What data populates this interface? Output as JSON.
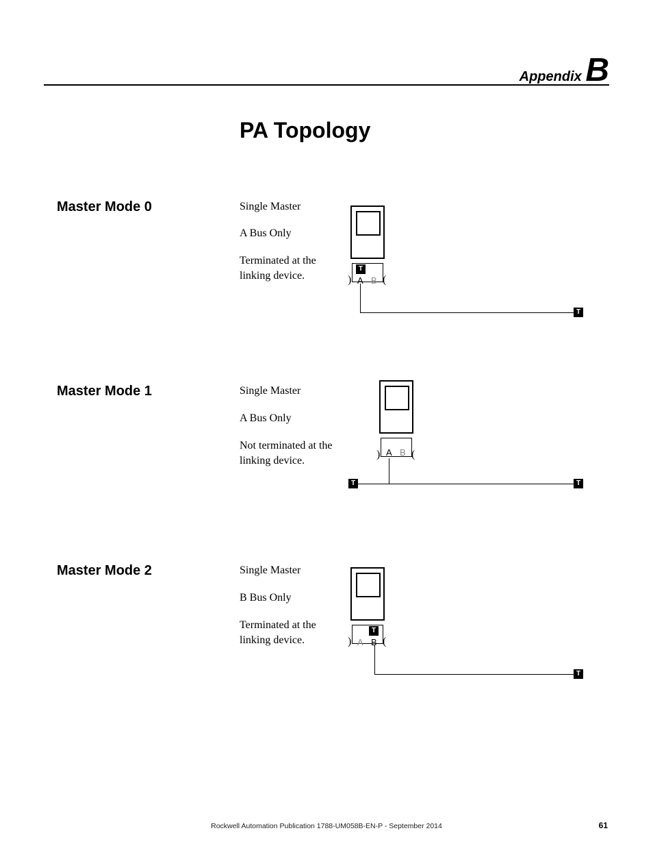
{
  "appendix": {
    "label": "Appendix",
    "letter": "B"
  },
  "title": "PA Topology",
  "sections": [
    {
      "heading": "Master Mode 0",
      "desc1": "Single Master",
      "desc2": "A Bus Only",
      "desc3": "Terminated at the linking device.",
      "portA": "A",
      "portB": "B",
      "t": "T",
      "a_active": true,
      "b_active": false,
      "has_t_at_device": true,
      "has_t_left": false
    },
    {
      "heading": "Master Mode 1",
      "desc1": "Single Master",
      "desc2": "A Bus Only",
      "desc3": "Not terminated at the linking device.",
      "portA": "A",
      "portB": "B",
      "t": "T",
      "a_active": true,
      "b_active": false,
      "has_t_at_device": false,
      "has_t_left": true
    },
    {
      "heading": "Master Mode 2",
      "desc1": "Single Master",
      "desc2": "B Bus Only",
      "desc3": "Terminated at the linking device.",
      "portA": "A",
      "portB": "B",
      "t": "T",
      "a_active": false,
      "b_active": true,
      "has_t_at_device": true,
      "has_t_left": false
    }
  ],
  "footer": {
    "pub": "Rockwell Automation Publication 1788-UM058B-EN-P - September 2014",
    "page": "61"
  }
}
